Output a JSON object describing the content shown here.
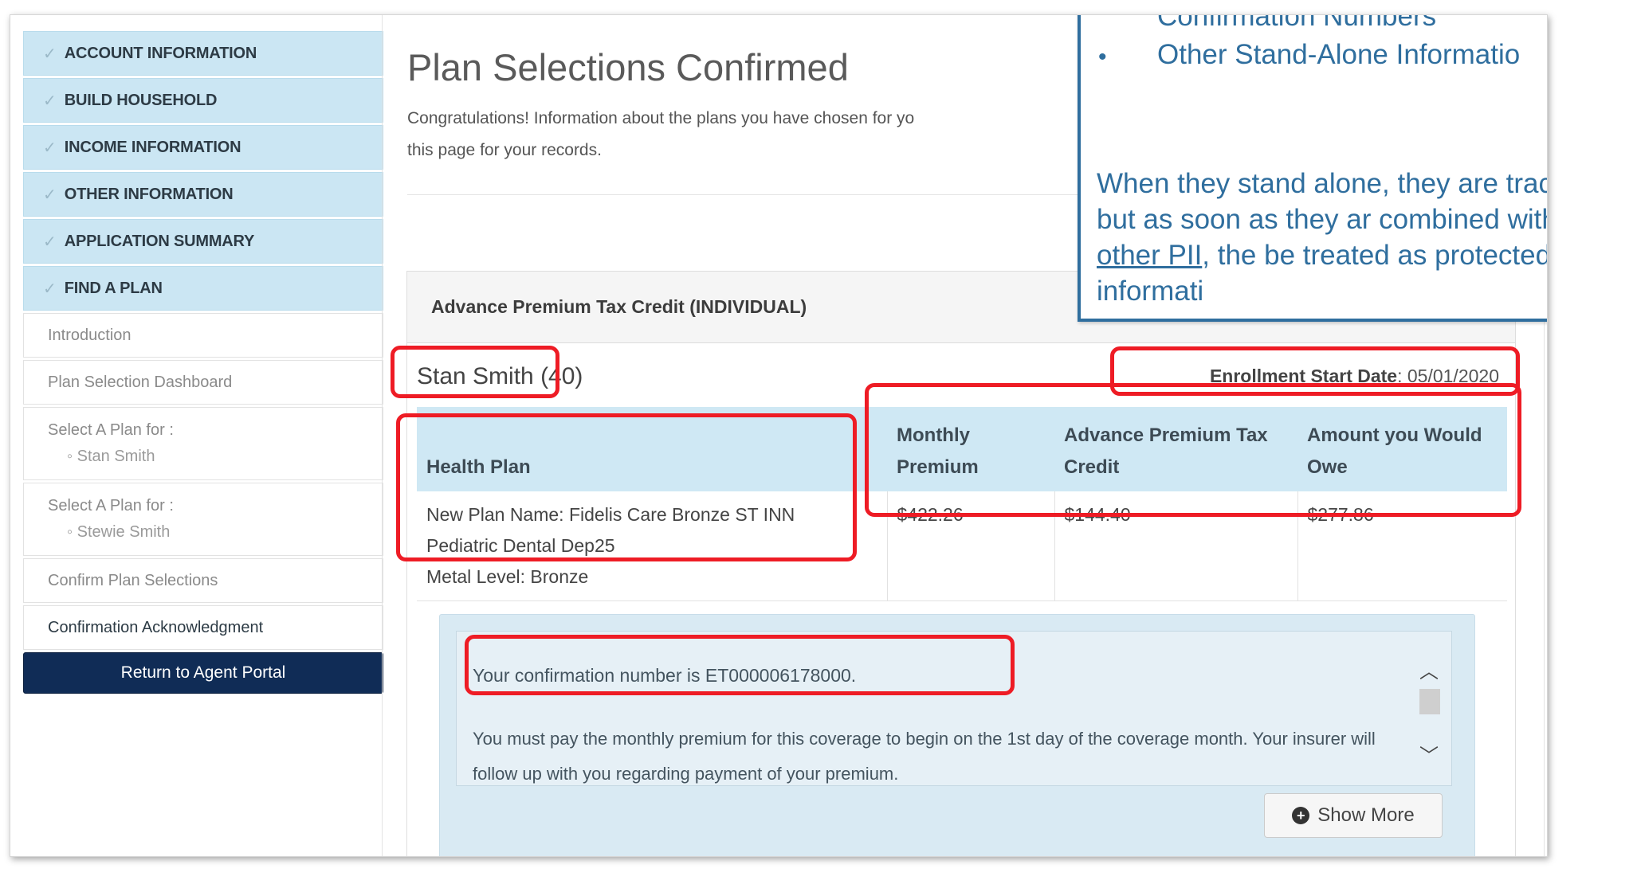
{
  "sidebar": {
    "completed_steps": [
      "ACCOUNT INFORMATION",
      "BUILD HOUSEHOLD",
      "INCOME INFORMATION",
      "OTHER INFORMATION",
      "APPLICATION SUMMARY",
      "FIND A PLAN"
    ],
    "sub_items": {
      "introduction": "Introduction",
      "dashboard": "Plan Selection Dashboard",
      "select_plan_1": "Select A Plan for :",
      "select_plan_1_person": "◦ Stan Smith",
      "select_plan_2": "Select A Plan for :",
      "select_plan_2_person": "◦ Stewie Smith",
      "confirm": "Confirm Plan Selections",
      "acknowledgment": "Confirmation Acknowledgment"
    },
    "return_button": "Return to Agent Portal"
  },
  "main": {
    "title": "Plan Selections Confirmed",
    "intro_line1": "Congratulations! Information about the plans you have chosen for yo",
    "intro_line2": "this page for your records.",
    "panel_title": "Advance Premium Tax Credit (INDIVIDUAL)",
    "person": "Stan Smith (40)",
    "enrollment_label": "Enrollment Start Date",
    "enrollment_value": ": 05/01/2020",
    "table": {
      "headers": [
        "Health Plan",
        "Monthly Premium",
        "Advance Premium Tax Credit",
        "Amount you Would Owe"
      ],
      "plan_lines": [
        "New Plan Name: Fidelis Care Bronze ST INN",
        "Pediatric Dental Dep25",
        "Metal Level: Bronze"
      ],
      "monthly_premium": "$422.26",
      "tax_credit": "$144.40",
      "amount_owed": "$277.86"
    },
    "notice": {
      "confirmation": "Your confirmation number is ET000006178000.",
      "message": "You must pay the monthly premium for this coverage to begin on the 1st day of the coverage month. Your insurer will follow up with you regarding payment of your premium."
    },
    "show_more": "Show More"
  },
  "callout": {
    "bullet_1": "Confirmation Numbers",
    "bullet_2": "Other Stand-Alone Informatio",
    "para_before": "When they stand alone, they are traceable, but as soon as they ar combined with ",
    "para_link": "any other PII",
    "para_after": ", the be treated as protected informati"
  },
  "icons": {
    "check": "checkmark-icon",
    "plus": "plus-circle-icon",
    "up": "chevron-up-icon",
    "down": "chevron-down-icon"
  },
  "colors": {
    "highlight": "#ee1c25",
    "callout": "#2f6e9e",
    "return_button": "#102c56",
    "step_done": "#cbe6f3"
  }
}
